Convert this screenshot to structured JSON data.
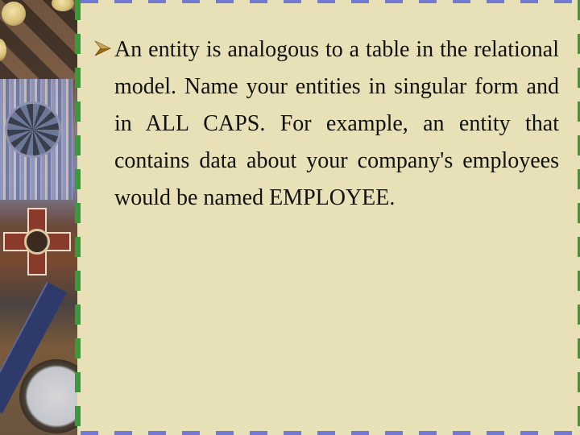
{
  "slide": {
    "background_color": "#e8e0b6",
    "border_top_color": "#7279d2",
    "border_left_color": "#3a9a3a",
    "side_image": {
      "description": "medals, ribbon, maltese cross and compass photo"
    },
    "bullets": [
      {
        "icon": "arrowhead-bullet-icon",
        "text": "An entity is analogous to a table in the relational model. Name your entities in singular form and in ALL CAPS. For example, an entity that contains data about your company's employees would be named EMPLOYEE."
      }
    ]
  }
}
